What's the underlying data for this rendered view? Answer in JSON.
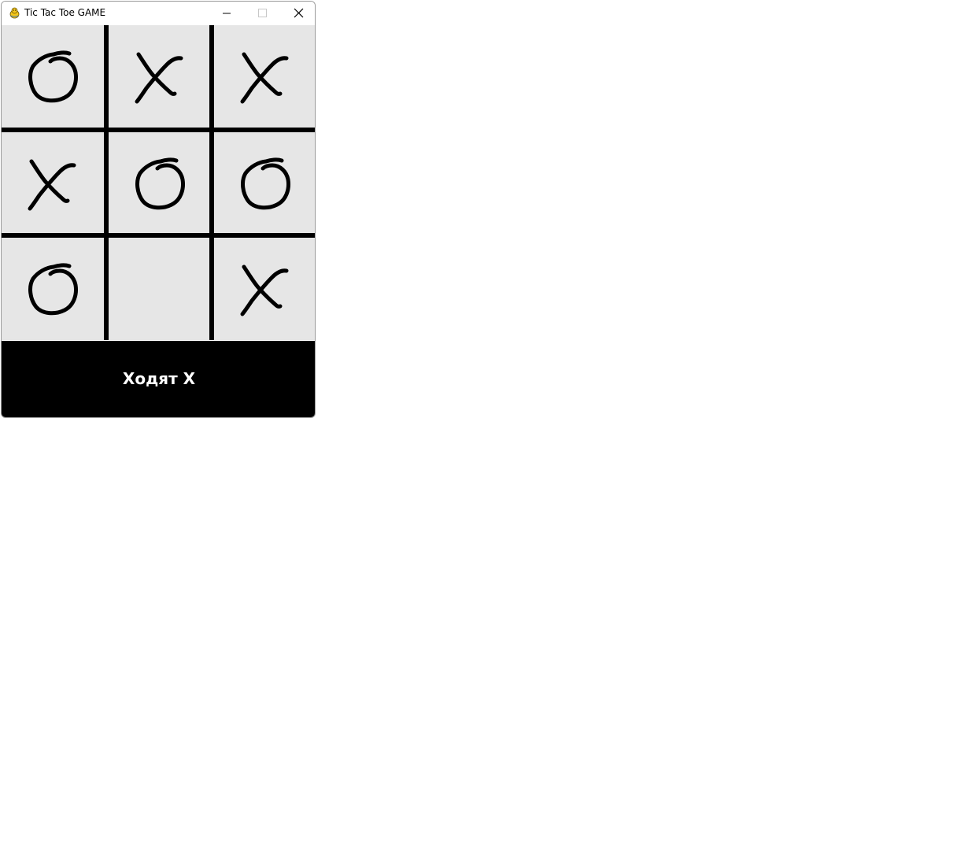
{
  "window": {
    "title": "Tic Tac Toe GAME",
    "icon": "pygame-snake-icon",
    "controls": [
      "minimize-icon",
      "maximize-icon",
      "close-icon"
    ]
  },
  "board": {
    "rows": [
      [
        "O",
        "X",
        "X"
      ],
      [
        "X",
        "O",
        "O"
      ],
      [
        "O",
        "",
        "X"
      ]
    ],
    "background_color": "#e6e6e6",
    "line_color": "#000000",
    "mark_color": "#000000"
  },
  "status": {
    "text": "Ходят X",
    "background_color": "#000000",
    "text_color": "#ffffff"
  }
}
